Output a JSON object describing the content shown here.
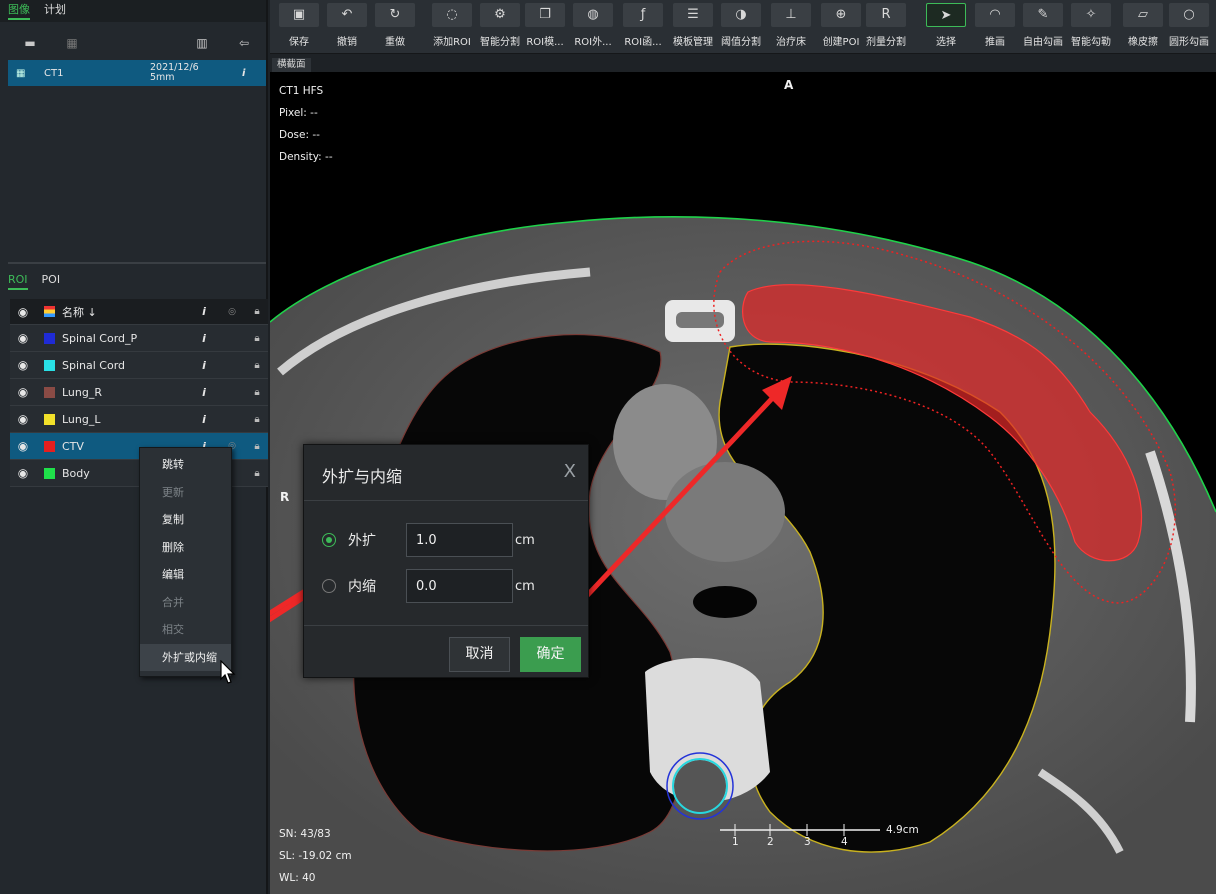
{
  "left_panel": {
    "tabs": [
      "图像",
      "计划"
    ],
    "image_series": {
      "name": "CT1",
      "date": "2021/12/6",
      "thickness": "5mm",
      "info": "i"
    },
    "roi_tabs": [
      "ROI",
      "POI"
    ],
    "roi_header": {
      "name": "名称 ↓",
      "info": "i"
    },
    "rois": [
      {
        "name": "Spinal Cord_P",
        "color": "#1f2bd6",
        "selected": false
      },
      {
        "name": "Spinal Cord",
        "color": "#29e0e6",
        "selected": false
      },
      {
        "name": "Lung_R",
        "color": "#8a4b45",
        "selected": false
      },
      {
        "name": "Lung_L",
        "color": "#f2e12a",
        "selected": false
      },
      {
        "name": "CTV",
        "color": "#e61f1f",
        "selected": true
      },
      {
        "name": "Body",
        "color": "#1fe04a",
        "selected": false
      }
    ]
  },
  "context_menu": {
    "items": [
      {
        "label": "跳转",
        "enabled": true
      },
      {
        "label": "更新",
        "enabled": false
      },
      {
        "label": "复制",
        "enabled": true
      },
      {
        "label": "删除",
        "enabled": true
      },
      {
        "label": "编辑",
        "enabled": true
      },
      {
        "label": "合并",
        "enabled": false
      },
      {
        "label": "相交",
        "enabled": false
      },
      {
        "label": "外扩或内缩",
        "enabled": true,
        "hovered": true
      }
    ]
  },
  "toolbar": {
    "buttons": [
      {
        "label": "保存",
        "icon": "save-icon",
        "glyph": "▣"
      },
      {
        "label": "撤销",
        "icon": "undo-icon",
        "glyph": "↶"
      },
      {
        "label": "重做",
        "icon": "redo-icon",
        "glyph": "↻"
      },
      {
        "label": "添加ROI",
        "icon": "add-roi-icon",
        "glyph": "◌"
      },
      {
        "label": "智能分割",
        "icon": "smart-segment-icon",
        "glyph": "⚙"
      },
      {
        "label": "ROI模...",
        "icon": "roi-template-icon",
        "glyph": "❐"
      },
      {
        "label": "ROI外...",
        "icon": "roi-expand-icon",
        "glyph": "◍"
      },
      {
        "label": "ROI函...",
        "icon": "roi-function-icon",
        "glyph": "ƒ"
      },
      {
        "label": "模板管理",
        "icon": "template-manage-icon",
        "glyph": "☰"
      },
      {
        "label": "阈值分割",
        "icon": "threshold-icon",
        "glyph": "◑"
      },
      {
        "label": "治疗床",
        "icon": "couch-icon",
        "glyph": "⊥"
      },
      {
        "label": "创建POI",
        "icon": "create-poi-icon",
        "glyph": "⊕"
      },
      {
        "label": "剂量分割",
        "icon": "dose-segment-icon",
        "glyph": "R"
      },
      {
        "label": "选择",
        "icon": "select-arrow-icon",
        "glyph": "➤",
        "selected": true
      },
      {
        "label": "推画",
        "icon": "push-draw-icon",
        "glyph": "◠"
      },
      {
        "label": "自由勾画",
        "icon": "freehand-icon",
        "glyph": "✎"
      },
      {
        "label": "智能勾勒",
        "icon": "smart-outline-icon",
        "glyph": "✧"
      },
      {
        "label": "橡皮擦",
        "icon": "eraser-icon",
        "glyph": "▱"
      },
      {
        "label": "圆形勾画",
        "icon": "circle-draw-icon",
        "glyph": "○"
      }
    ]
  },
  "viewport": {
    "tab": "横截面",
    "orientation_top": "A",
    "orientation_left": "R",
    "overlay_top_left": [
      "CT1 HFS",
      "Pixel: --",
      "Dose: --",
      "Density: --"
    ],
    "overlay_bottom_left": [
      "SN: 43/83",
      "SL: -19.02 cm",
      "WL: 40"
    ],
    "scale_label": "4.9cm",
    "scale_ticks": [
      "1",
      "2",
      "3",
      "4"
    ]
  },
  "dialog": {
    "title": "外扩与内缩",
    "close": "X",
    "expand_label": "外扩",
    "expand_value": "1.0",
    "shrink_label": "内缩",
    "shrink_value": "0.0",
    "unit": "cm",
    "selected": "expand",
    "cancel": "取消",
    "ok": "确定"
  }
}
